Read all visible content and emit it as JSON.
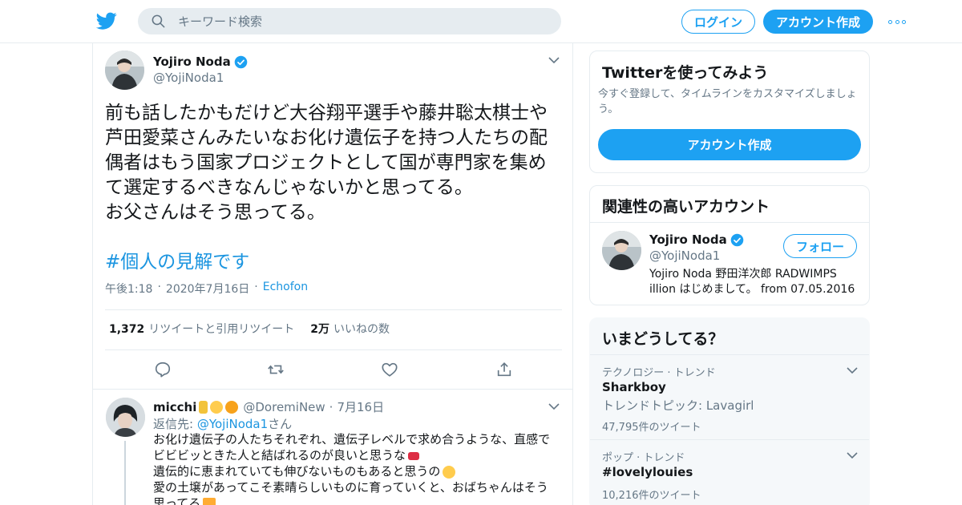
{
  "header": {
    "search_placeholder": "キーワード検索",
    "login_label": "ログイン",
    "signup_label": "アカウント作成",
    "brand_color": "#1da1f2"
  },
  "tweet": {
    "author_name": "Yojiro Noda",
    "author_handle": "@YojiNoda1",
    "verified": true,
    "text_lines": [
      "前も話したかもだけど大谷翔平選手や藤井聡太棋士や",
      "芦田愛菜さんみたいなお化け遺伝子を持つ人たちの配",
      "偶者はもう国家プロジェクトとして国が専門家を集め",
      "て選定するべきなんじゃないかと思ってる。",
      "お父さんはそう思ってる。"
    ],
    "hashtag": "#個人の見解です",
    "time": "午後1:18",
    "date": "2020年7月16日",
    "source": "Echofon",
    "retweet_count": "1,372",
    "retweet_label": "リツイートと引用リツイート",
    "like_count": "2万",
    "like_label": "いいねの数",
    "actions": [
      "reply-icon",
      "retweet-icon",
      "like-icon",
      "share-icon"
    ]
  },
  "reply": {
    "name": "micchi",
    "handle": "@DoremiNew",
    "date": "7月16日",
    "reply_to_prefix": "返信先: ",
    "reply_to_mention": "@YojiNoda1",
    "reply_to_suffix": "さん",
    "text_lines": [
      "お化け遺伝子の人たちそれぞれ、遺伝子レベルで求め合うような、直感で",
      "ビビビッときた人と結ばれるのが良いと思うな",
      "遺伝的に恵まれていても伸びないものもあると思うの",
      "愛の土壌があってこそ素晴らしいものに育っていくと、おばちゃんはそう",
      "思ってる"
    ]
  },
  "sidebar": {
    "signup_card": {
      "title": "Twitterを使ってみよう",
      "description": "今すぐ登録して、タイムラインをカスタマイズしましょう。",
      "button_label": "アカウント作成"
    },
    "related": {
      "title": "関連性の高いアカウント",
      "name": "Yojiro Noda",
      "handle": "@YojiNoda1",
      "follow_label": "フォロー",
      "bio_lines": [
        "Yojiro Noda 野田洋次郎 RADWIMPS",
        "illion はじめまして。 from 07.05.2016"
      ]
    },
    "trends": {
      "title": "いまどうしてる？",
      "items": [
        {
          "category": "テクノロジー · トレンド",
          "name": "Sharkboy",
          "subtitle": "トレンドトピック: Lavagirl",
          "count": "47,795件のツイート"
        },
        {
          "category": "ポップ · トレンド",
          "name": "#lovelylouies",
          "subtitle": "",
          "count": "10,216件のツイート"
        }
      ]
    }
  }
}
